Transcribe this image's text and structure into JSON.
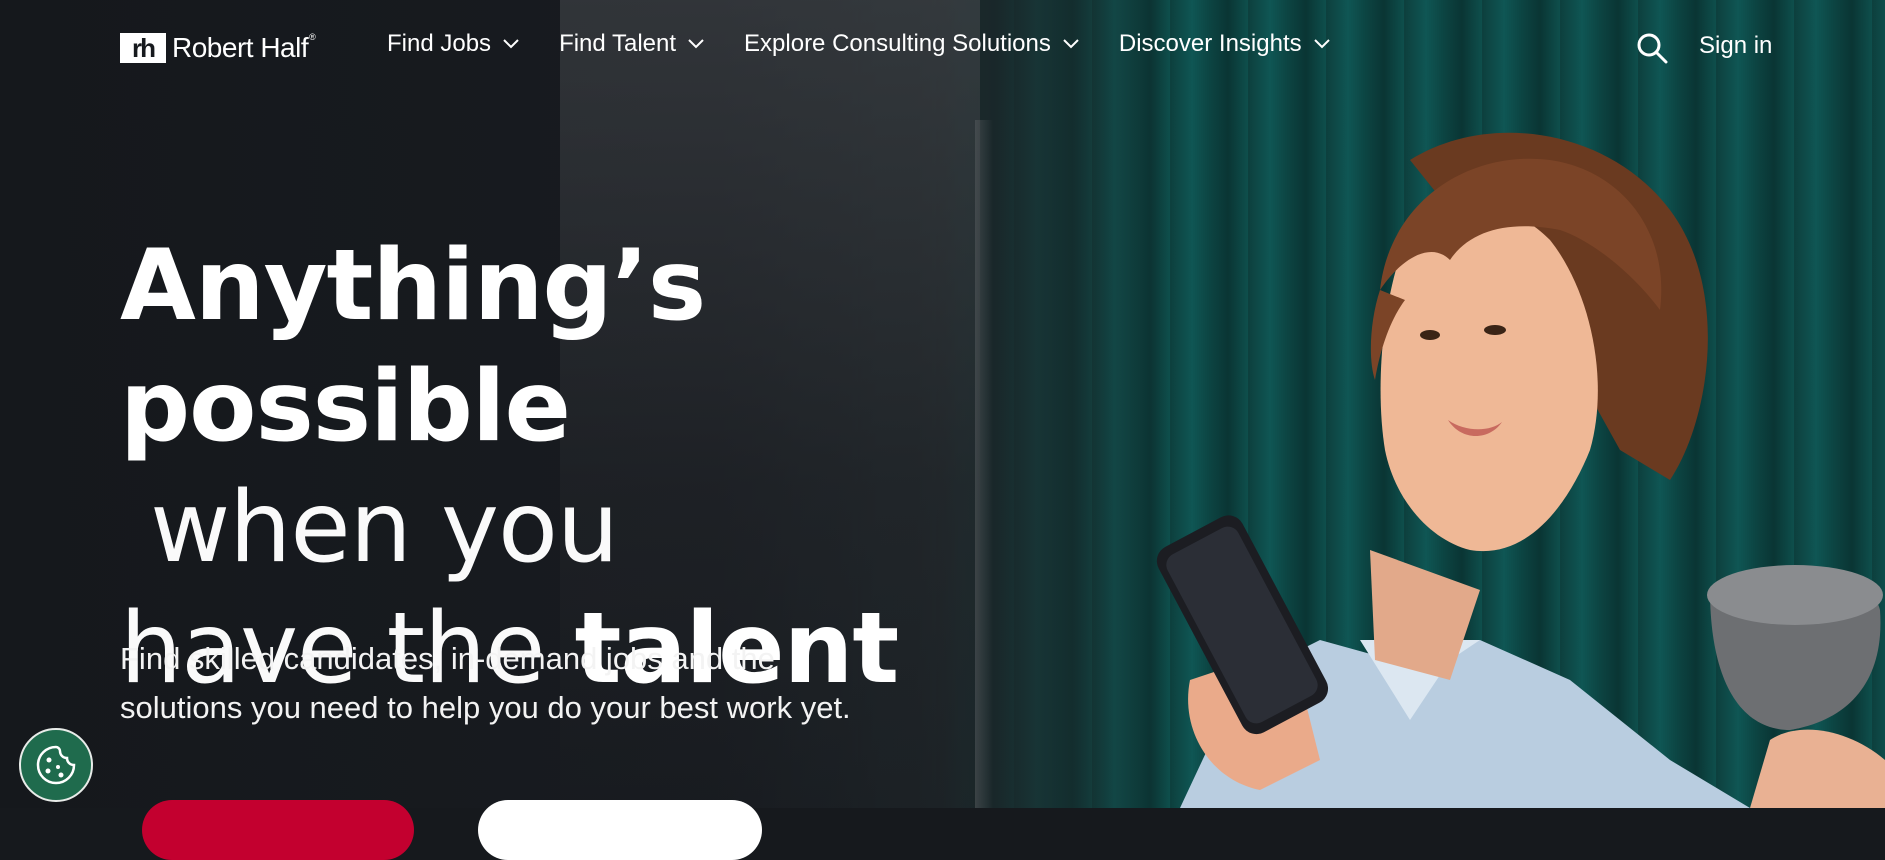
{
  "brand": {
    "name": "Robert Half",
    "mark": "rh",
    "reg": "®"
  },
  "nav": {
    "items": [
      {
        "label": "Find Jobs",
        "icon": "chevron-down-icon"
      },
      {
        "label": "Find Talent",
        "icon": "chevron-down-icon"
      },
      {
        "label": "Explore Consulting Solutions",
        "icon": "chevron-down-icon"
      },
      {
        "label": "Discover Insights",
        "icon": "chevron-down-icon"
      }
    ],
    "search_icon": "search-icon",
    "signin_label": "Sign in"
  },
  "hero": {
    "headline": {
      "part1": "Anything’s",
      "part2_bold": "possible",
      "part2_thin": " when you",
      "part3_thin": "have the ",
      "part3_bold": "talent"
    },
    "subline1": "Find skilled candidates, in-demand jobs and the",
    "subline2": "solutions you need to help you do your best work yet."
  },
  "cookie": {
    "icon": "cookie-icon"
  },
  "colors": {
    "background": "#16191d",
    "brand_red": "#c3002f",
    "curtain_teal": "#0f5654",
    "cookie_green": "#1f6b4d"
  }
}
